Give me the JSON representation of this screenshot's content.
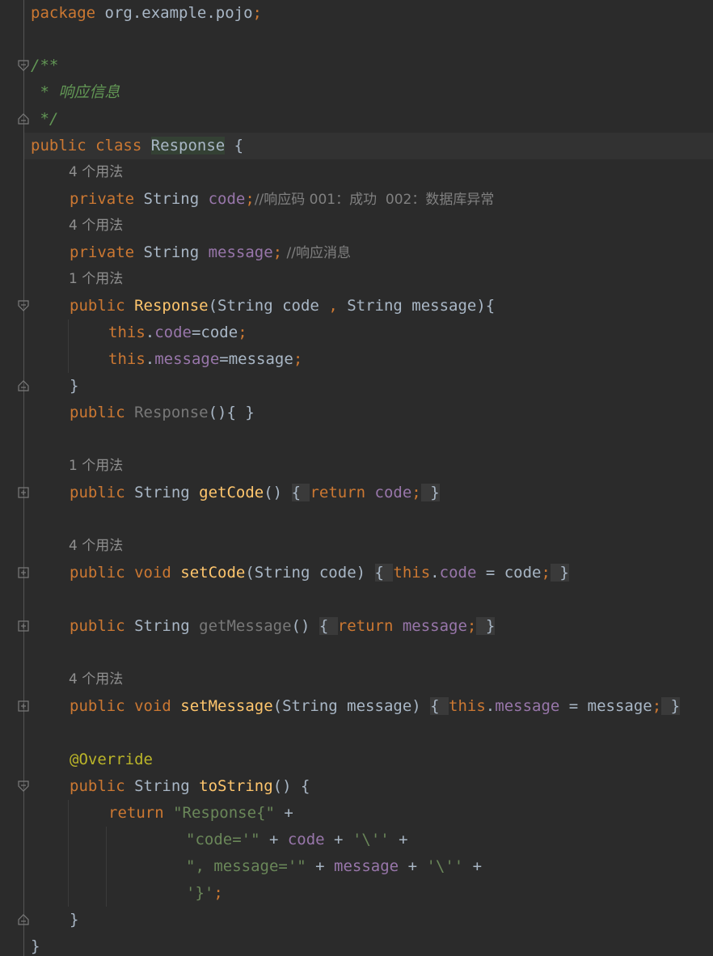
{
  "editor": {
    "language": "Java",
    "colors": {
      "background": "#2b2b2b",
      "keyword": "#cc7832",
      "function": "#ffc66d",
      "field": "#9876aa",
      "string": "#6a8759",
      "comment": "#808080",
      "doc_comment": "#629755",
      "annotation": "#bbb529",
      "default_text": "#a9b7c6"
    },
    "hints": {
      "usages_4": "4 个用法",
      "usages_1": "1 个用法"
    },
    "code": {
      "l1_kw": "package",
      "l1_pkg": " org.example.pojo",
      "l1_semi": ";",
      "doc_open": "/**",
      "doc_body": " * 响应信息",
      "doc_close": " */",
      "class_kw": "public class ",
      "class_name": "Response",
      "class_open": " {",
      "f1_kw": "private ",
      "f1_type": "String ",
      "f1_name": "code",
      "f1_semi": ";",
      "f1_comment": "//响应码 001：成功  002：数据库异常",
      "f2_kw": "private ",
      "f2_type": "String ",
      "f2_name": "message",
      "f2_semi": ";",
      "f2_comment": " //响应消息",
      "c1_kw": "public ",
      "c1_name": "Response",
      "c1_p1": "(String code ",
      "c1_comma": ",",
      "c1_p2": " String message){",
      "c1_b1_this": "this",
      "c1_b1_dot": ".",
      "c1_b1_fld": "code",
      "c1_b1_rest": "=code",
      "c1_b1_semi": ";",
      "c1_b2_this": "this",
      "c1_b2_dot": ".",
      "c1_b2_fld": "message",
      "c1_b2_rest": "=message",
      "c1_b2_semi": ";",
      "close_brace": "}",
      "c2_kw": "public ",
      "c2_name": "Response",
      "c2_rest": "(){ }",
      "m1_kw": "public ",
      "m1_type": "String ",
      "m1_name": "getCode",
      "m1_paren": "() ",
      "m1_ob": "{ ",
      "m1_ret": "return ",
      "m1_fld": "code",
      "m1_semi": ";",
      "m1_cb": " }",
      "m2_kw": "public void ",
      "m2_name": "setCode",
      "m2_paren": "(String code) ",
      "m2_ob": "{ ",
      "m2_this": "this",
      "m2_dot": ".",
      "m2_fld": "code",
      "m2_rest": " = code",
      "m2_semi": ";",
      "m2_cb": " }",
      "m3_kw": "public ",
      "m3_type": "String ",
      "m3_name": "getMessage",
      "m3_paren": "() ",
      "m3_ob": "{ ",
      "m3_ret": "return ",
      "m3_fld": "message",
      "m3_semi": ";",
      "m3_cb": " }",
      "m4_kw": "public void ",
      "m4_name": "setMessage",
      "m4_paren": "(String message) ",
      "m4_ob": "{ ",
      "m4_this": "this",
      "m4_dot": ".",
      "m4_fld": "message",
      "m4_rest": " = message",
      "m4_semi": ";",
      "m4_cb": " }",
      "annotation": "@Override",
      "ts_kw": "public ",
      "ts_type": "String ",
      "ts_name": "toString",
      "ts_rest": "() {",
      "r1_ret": "return ",
      "r1_str": "\"Response{\"",
      "r1_plus": " +",
      "r2_str1": "\"code='\"",
      "r2_p1": " + ",
      "r2_fld": "code",
      "r2_p2": " + ",
      "r2_str2": "'\\''",
      "r2_p3": " +",
      "r3_str1": "\", message='\"",
      "r3_p1": " + ",
      "r3_fld": "message",
      "r3_p2": " + ",
      "r3_str2": "'\\''",
      "r3_p3": " +",
      "r4_str": "'}'",
      "r4_semi": ";"
    }
  }
}
